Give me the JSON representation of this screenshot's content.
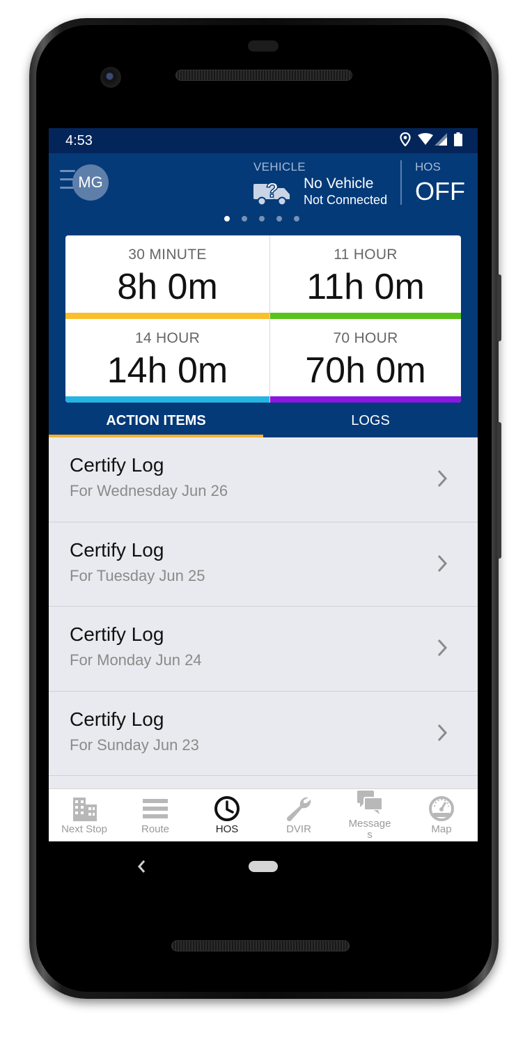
{
  "status_bar": {
    "time": "4:53"
  },
  "header": {
    "avatar_initials": "MG",
    "vehicle_label": "VEHICLE",
    "vehicle_name": "No Vehicle",
    "vehicle_status": "Not Connected",
    "hos_label": "HOS",
    "hos_value": "OFF",
    "page_dots": 5,
    "active_dot": 1
  },
  "timers": [
    {
      "label": "30 MINUTE",
      "value": "8h 0m",
      "color": "#f9bf2c"
    },
    {
      "label": "11 HOUR",
      "value": "11h 0m",
      "color": "#5ac21c"
    },
    {
      "label": "14 HOUR",
      "value": "14h 0m",
      "color": "#26b4e3"
    },
    {
      "label": "70 HOUR",
      "value": "70h 0m",
      "color": "#8a17e0"
    }
  ],
  "tabs": [
    {
      "label": "ACTION ITEMS",
      "active": true
    },
    {
      "label": "LOGS",
      "active": false
    }
  ],
  "action_items": [
    {
      "title": "Certify Log",
      "subtitle": "For Wednesday Jun 26"
    },
    {
      "title": "Certify Log",
      "subtitle": "For Tuesday Jun 25"
    },
    {
      "title": "Certify Log",
      "subtitle": "For Monday Jun 24"
    },
    {
      "title": "Certify Log",
      "subtitle": "For Sunday Jun 23"
    }
  ],
  "bottom_nav": [
    {
      "label": "Next Stop",
      "icon": "building-icon",
      "active": false
    },
    {
      "label": "Route",
      "icon": "list-icon",
      "active": false
    },
    {
      "label": "HOS",
      "icon": "clock-icon",
      "active": true
    },
    {
      "label": "DVIR",
      "icon": "wrench-icon",
      "active": false
    },
    {
      "label": "Message\ns",
      "icon": "messages-icon",
      "active": false
    },
    {
      "label": "Map",
      "icon": "speedometer-icon",
      "active": false
    }
  ],
  "colors": {
    "header_bg": "#043a78",
    "status_bar_bg": "#04255a",
    "accent": "#f5b130",
    "list_bg": "#e9eaef"
  }
}
